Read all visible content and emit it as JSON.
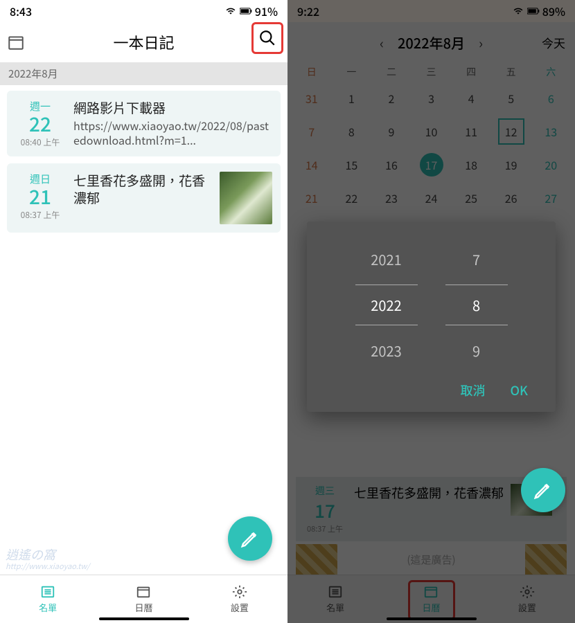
{
  "left": {
    "status": {
      "time": "8:43",
      "battery": "91%"
    },
    "appbar": {
      "title": "一本日記"
    },
    "section": "2022年8月",
    "entries": [
      {
        "dow": "週一",
        "day": "22",
        "time": "08:40 上午",
        "title": "網路影片下載器",
        "url": "https://www.xiaoyao.tw/2022/08/pastedownload.html?m=1..."
      },
      {
        "dow": "週日",
        "day": "21",
        "time": "08:37 上午",
        "title": "七里香花多盛開，花香濃郁"
      }
    ],
    "watermark": {
      "main": "逍遙の窩",
      "sub": "http://www.xiaoyao.tw/"
    },
    "nav": {
      "list": "名單",
      "cal": "日曆",
      "settings": "設置"
    }
  },
  "right": {
    "status": {
      "time": "9:22",
      "battery": "89%"
    },
    "header": {
      "month": "2022年8月",
      "today": "今天"
    },
    "dow": [
      "日",
      "一",
      "二",
      "三",
      "四",
      "五",
      "六"
    ],
    "weeks": [
      [
        "31",
        "1",
        "2",
        "3",
        "4",
        "5",
        "6"
      ],
      [
        "7",
        "8",
        "9",
        "10",
        "11",
        "12",
        "13"
      ],
      [
        "14",
        "15",
        "16",
        "17",
        "18",
        "19",
        "20"
      ],
      [
        "21",
        "22",
        "23",
        "24",
        "25",
        "26",
        "27"
      ]
    ],
    "todayCell": "12",
    "selectedCell": "17",
    "dialog": {
      "years": [
        "2021",
        "2022",
        "2023"
      ],
      "months": [
        "7",
        "8",
        "9"
      ],
      "cancel": "取消",
      "ok": "OK"
    },
    "entry": {
      "dow": "週三",
      "day": "17",
      "time": "08:37 上午",
      "title": "七里香花多盛開，花香濃郁"
    },
    "ad": "(這是廣告)",
    "nav": {
      "list": "名單",
      "cal": "日曆",
      "settings": "設置"
    }
  }
}
